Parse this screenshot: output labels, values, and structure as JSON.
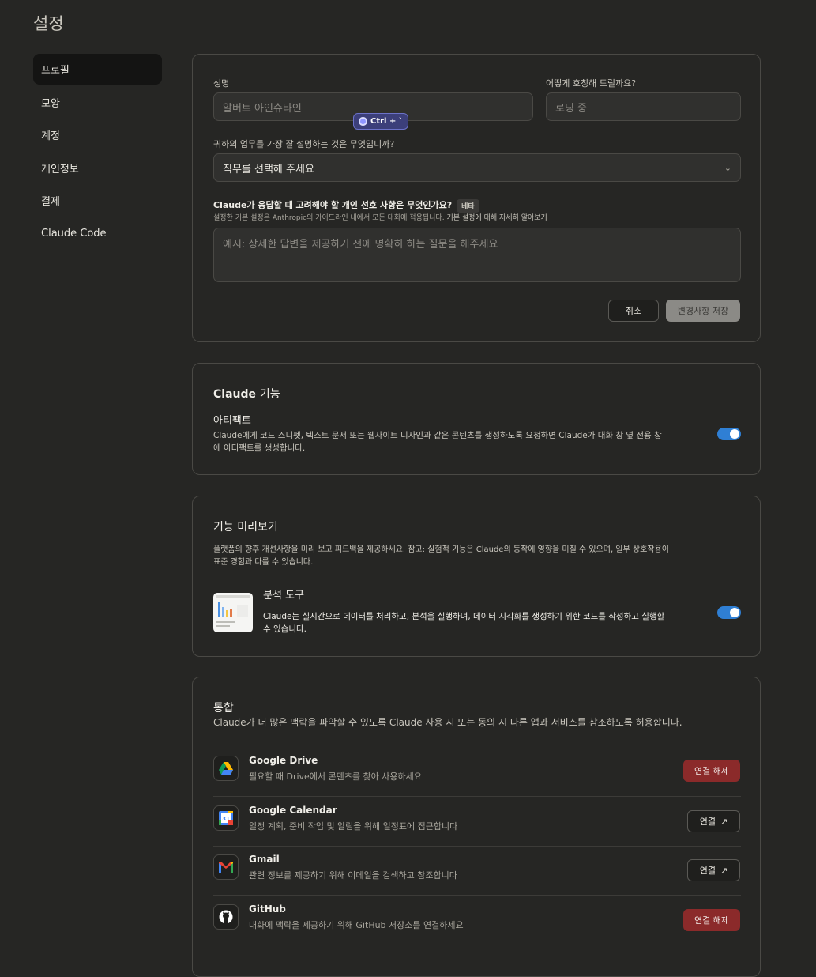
{
  "title": "설정",
  "sidebar": {
    "items": [
      {
        "label": "프로필"
      },
      {
        "label": "모양"
      },
      {
        "label": "계정"
      },
      {
        "label": "개인정보"
      },
      {
        "label": "결제"
      },
      {
        "label": "Claude Code"
      }
    ]
  },
  "profile": {
    "name_label": "성명",
    "name_placeholder": "알버트 아인슈타인",
    "call_label": "어떻게 호칭해 드릴까요?",
    "call_value": "로딩 중",
    "shortcut_badge": "Ctrl + `",
    "work_label": "귀하의 업무를 가장 잘 설명하는 것은 무엇입니까?",
    "work_select": "직무를 선택해 주세요",
    "pref_label": "Claude가 응답할 때 고려해야 할 개인 선호 사항은 무엇인가요?",
    "beta_badge": "베타",
    "pref_hint": "설정한 기본 설정은 Anthropic의 가이드라인 내에서 모든 대화에 적용됩니다.",
    "pref_link": "기본 설정에 대해 자세히 알아보기",
    "pref_placeholder": "예시: 상세한 답변을 제공하기 전에 명확히 하는 질문을 해주세요",
    "cancel": "취소",
    "save": "변경사항 저장"
  },
  "features": {
    "title_en": "Claude",
    "title_ko": "기능",
    "artifacts_title": "아티팩트",
    "artifacts_desc_1": "Claude에게 코드 스니펫, 텍스트 문서 또는 웹사이트 디자인과 같은 콘텐츠를 생성하도록 요청하면 Claude가 대화 창 옆 전용 창",
    "artifacts_desc_2": "에 아티팩트를 생성합니다.",
    "artifacts_enabled": true
  },
  "preview": {
    "title": "기능 미리보기",
    "desc_1": "플랫폼의 향후 개선사항을 미리 보고 피드백을 제공하세요. 참고: 실험적 기능은 Claude의 동작에 영향을 미칠 수 있으며, 일부 상호작용이",
    "desc_2": "표준 경험과 다를 수 있습니다.",
    "analysis_title": "분석 도구",
    "analysis_desc_1": "Claude는 실시간으로 데이터를 처리하고, 분석을 실행하며, 데이터 시각화를 생성하기 위한 코드를 작성하고 실행할",
    "analysis_desc_2": "수 있습니다.",
    "analysis_enabled": true
  },
  "integrations": {
    "title": "통합",
    "desc": "Claude가 더 많은 맥락을 파악할 수 있도록 Claude 사용 시 또는 동의 시 다른 앱과 서비스를 참조하도록 허용합니다.",
    "items": [
      {
        "name": "Google Drive",
        "desc": "필요할 때 Drive에서 콘텐츠를 찾아 사용하세요",
        "action": "연결 해제",
        "icon": "google-drive-icon"
      },
      {
        "name": "Google Calendar",
        "desc": "일정 계획, 준비 작업 및 알림을 위해 일정표에 접근합니다",
        "action": "연결",
        "icon": "google-calendar-icon"
      },
      {
        "name": "Gmail",
        "desc": "관련 정보를 제공하기 위해 이메일을 검색하고 참조합니다",
        "action": "연결",
        "icon": "gmail-icon"
      },
      {
        "name": "GitHub",
        "desc": "대화에 맥락을 제공하기 위해 GitHub 저장소를 연결하세요",
        "action": "연결 해제",
        "icon": "github-icon"
      }
    ],
    "calendar_day": "31"
  },
  "colors": {
    "background": "#262624",
    "accent_toggle": "#2f7fd4",
    "danger": "#8b2a2a"
  }
}
